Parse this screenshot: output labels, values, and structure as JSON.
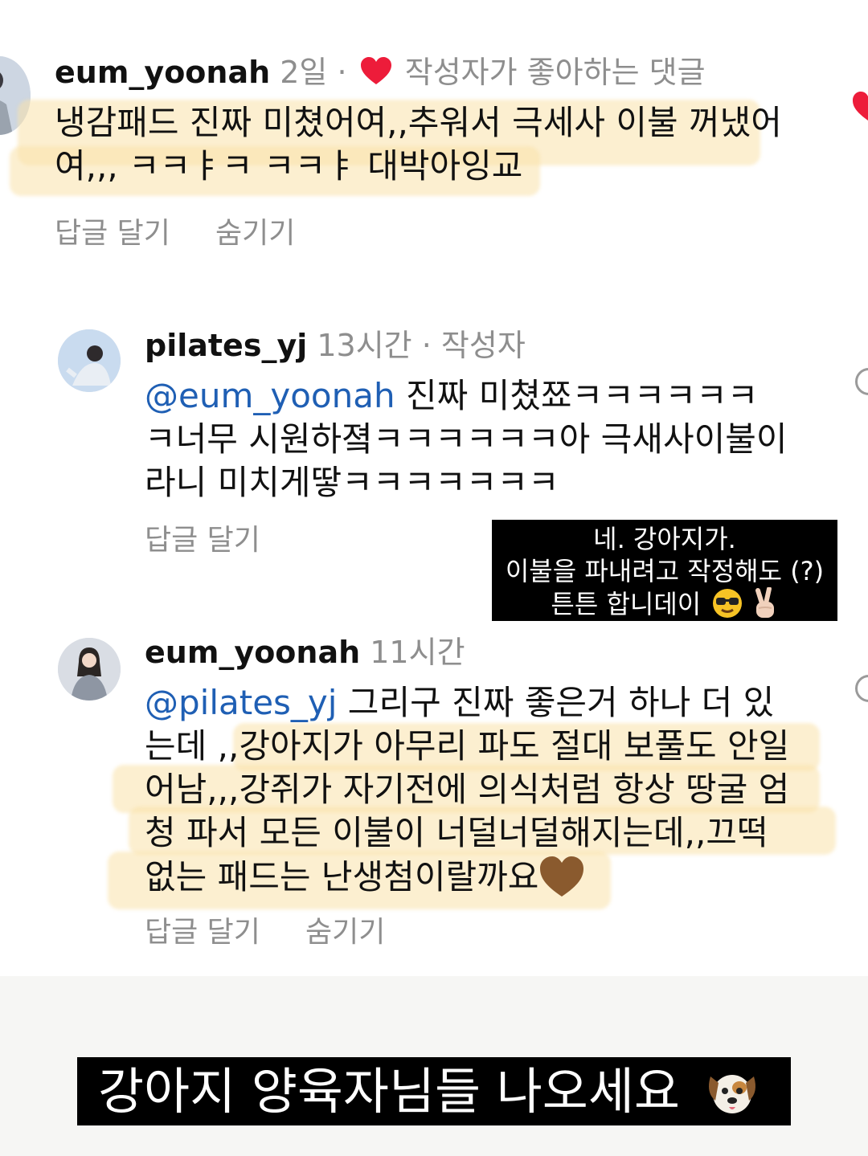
{
  "comments": [
    {
      "username": "eum_yoonah",
      "time": "2일",
      "dot": "·",
      "liked_label": "작성자가 좋아하는 댓글",
      "lines": [
        "냉감패드 진짜 미쳤어여,,추워서 극세사 이불 꺼냈어",
        "여,,, ㅋㅋㅑㅋ ㅋㅋㅑ 대박아잉교"
      ],
      "reply_label": "답글 달기",
      "hide_label": "숨기기"
    },
    {
      "username": "pilates_yj",
      "time": "13시간",
      "dot": "·",
      "author_label": "작성자",
      "mention": "@eum_yoonah",
      "line1_rest": " 진짜 미쳤쬬ㅋㅋㅋㅋㅋㅋ",
      "lines": [
        "ㅋ너무 시원하졐ㅋㅋㅋㅋㅋㅋ아 극새사이불이",
        "라니 미치게땋ㅋㅋㅋㅋㅋㅋㅋ"
      ],
      "reply_label": "답글 달기"
    },
    {
      "username": "eum_yoonah",
      "time": "11시간",
      "mention": "@pilates_yj",
      "line1_rest": " 그리구 진짜 좋은거 하나 더 있",
      "lines": [
        "는데 ,,강아지가 아무리 파도 절대 보풀도 안일",
        "어남,,,강쥐가 자기전에 의식처럼 항상 땅굴 엄",
        "청 파서 모든 이불이 너덜너덜해지는데,,끄떡",
        "없는 패드는 난생첨이랄까요"
      ],
      "reply_label": "답글 달기",
      "hide_label": "숨기기"
    }
  ],
  "overlay_caption": {
    "lines": [
      "네. 강아지가.",
      "이불을 파내려고 작정해도 (?)",
      "튼튼 합니데이"
    ]
  },
  "bottom_caption": "강아지 양육자님들 나오세요",
  "icons": {
    "like": "heart-icon",
    "overlay_1": "sunglasses-emoji-icon",
    "overlay_2": "peace-hand-emoji-icon",
    "comment_end": "brown-heart-emoji-icon",
    "caption_end": "dog-face-emoji-icon"
  },
  "colors": {
    "mention": "#1f5fb4",
    "muted": "#8e8e8e",
    "heart": "#ed1c3a",
    "highlight": "#fae2aa"
  }
}
